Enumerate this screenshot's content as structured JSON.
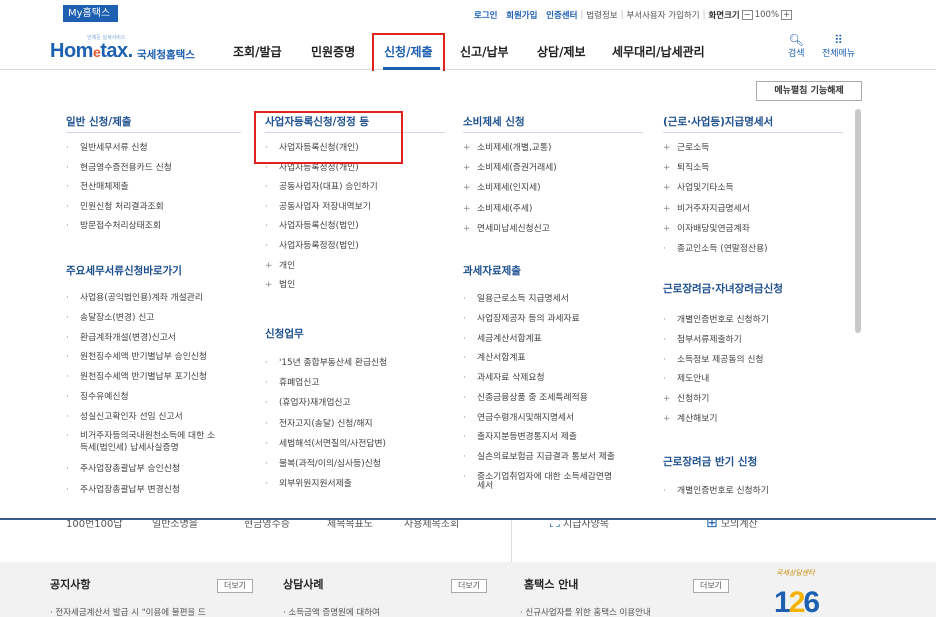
{
  "topbar": {
    "myhome": "My홈택스",
    "links": [
      "로그인",
      "회원가입",
      "인증센터",
      "법령정보",
      "부서사용자 가입하기",
      "화면크기"
    ],
    "zoom_minus": "−",
    "zoom_value": "100%",
    "zoom_plus": "+"
  },
  "header": {
    "logo_sub": "언제든 실세서비스",
    "logo_main_a": "Hom",
    "logo_main_e": "e",
    "logo_main_b": "tax.",
    "logo_kr": "국세청홈택스",
    "nav": [
      "조회/발급",
      "민원증명",
      "신청/제출",
      "신고/납부",
      "상담/제보",
      "세무대리/납세관리"
    ],
    "active_nav": "신청/제출",
    "search_label": "검색",
    "allmenu_label": "전체메뉴",
    "accent": "#1d5fb0",
    "highlight": "#e0231f"
  },
  "mega": {
    "collapse_btn": "메뉴펼침 기능해제",
    "col1": {
      "title1": "일반 신청/제출",
      "items1": [
        "일반세무서류 신청",
        "현금영수증전용카드 신청",
        "전산매체제출",
        "민원신청 처리결과조회",
        "방문접수처리상태조회"
      ],
      "title2": "주요세무서류신청바로가기",
      "items2": [
        "사업용(공익법인용)계좌 개설관리",
        "송달장소(변경) 신고",
        "환급계좌개설(변경)신고서",
        "원천징수세액 반기별납부 승인신청",
        "원천징수세액 반기별납부 포기신청",
        "징수유예신청",
        "성실신고확인자 선임 신고서",
        "비거주자등의국내원천소득에 대한 소",
        "득세(법인세) 납세사실증명",
        "주사업장총괄납부 승인신청",
        "주사업장총괄납부 변경신청"
      ]
    },
    "col2": {
      "title1": "사업자등록신청/정정 등",
      "items1": [
        "사업자등록신청(개인)",
        "사업자등록정정(개인)",
        "공동사업자(대표) 승인하기",
        "공동사업자 저장내역보기",
        "사업자등록신청(법인)",
        "사업자등록정정(법인)",
        "개인",
        "법인"
      ],
      "title2": "신청업무",
      "items2": [
        "'15년 종합부동산세 환급신청",
        "휴폐업신고",
        "(휴업자)재개업신고",
        "전자고지(송달) 신청/해지",
        "세법해석(서면질의/사전답변)",
        "불복(과적/이의/심사등)신청",
        "외부위원지원서제출"
      ]
    },
    "col3": {
      "title1": "소비제세 신청",
      "items1": [
        "소비제세(개별,교통)",
        "소비제세(증권거래세)",
        "소비제세(인지세)",
        "소비제세(주세)",
        "면세미납세신청신고"
      ],
      "title2": "과세자료제출",
      "items2": [
        "일용근로소득 지급명세서",
        "사업장제공자 등의 과세자료",
        "세금계산서합계표",
        "계산서합계표",
        "과세자료 삭제요청",
        "신종금융상품 중 조세특례적용",
        "연금수령개시및해지명세서",
        "출자지분등변경통지서 제출",
        "실손의료보험금 지급결과 통보서 제출",
        "중소기업취업자에 대한 소득세감면명",
        "세서"
      ]
    },
    "col4": {
      "title1": "(근로·사업등)지급명세서",
      "items1": [
        "근로소득",
        "퇴직소득",
        "사업및기타소득",
        "비거주자지급명세서",
        "이자배당및연금계좌",
        "종교인소득 (연말정산용)"
      ],
      "title2": "근로장려금·자녀장려금신청",
      "items2": [
        "개별인증번호로 신청하기",
        "첨부서류제출하기",
        "소득정보 제공동의 신청",
        "제도안내",
        "신청하기",
        "계산해보기"
      ],
      "title3": "근로장려금 반기 신청",
      "items3": [
        "개별인증번호로 신청하기"
      ]
    }
  },
  "under": {
    "texts": [
      "100번100답",
      "일반소명을",
      "현금영수증",
      "제목목표노",
      "사용제목조회",
      "지급사양목",
      "모의계산"
    ]
  },
  "footer": {
    "notice_title": "공지사항",
    "notice_more": "더보기",
    "notice_item": "전자세금계산서 발급 시 \"이용에 불편을 드",
    "case_title": "상담사례",
    "case_more": "더보기",
    "case_item": "소득금액 증명원에 대하여",
    "guide_title": "홈택스 안내",
    "guide_more": "더보기",
    "guide_item": "신규사업자를 위한 홈택스 이용안내",
    "center_caption": "국세상담센터",
    "center_num_a": "1",
    "center_num_b": "2",
    "center_num_c": "6"
  }
}
